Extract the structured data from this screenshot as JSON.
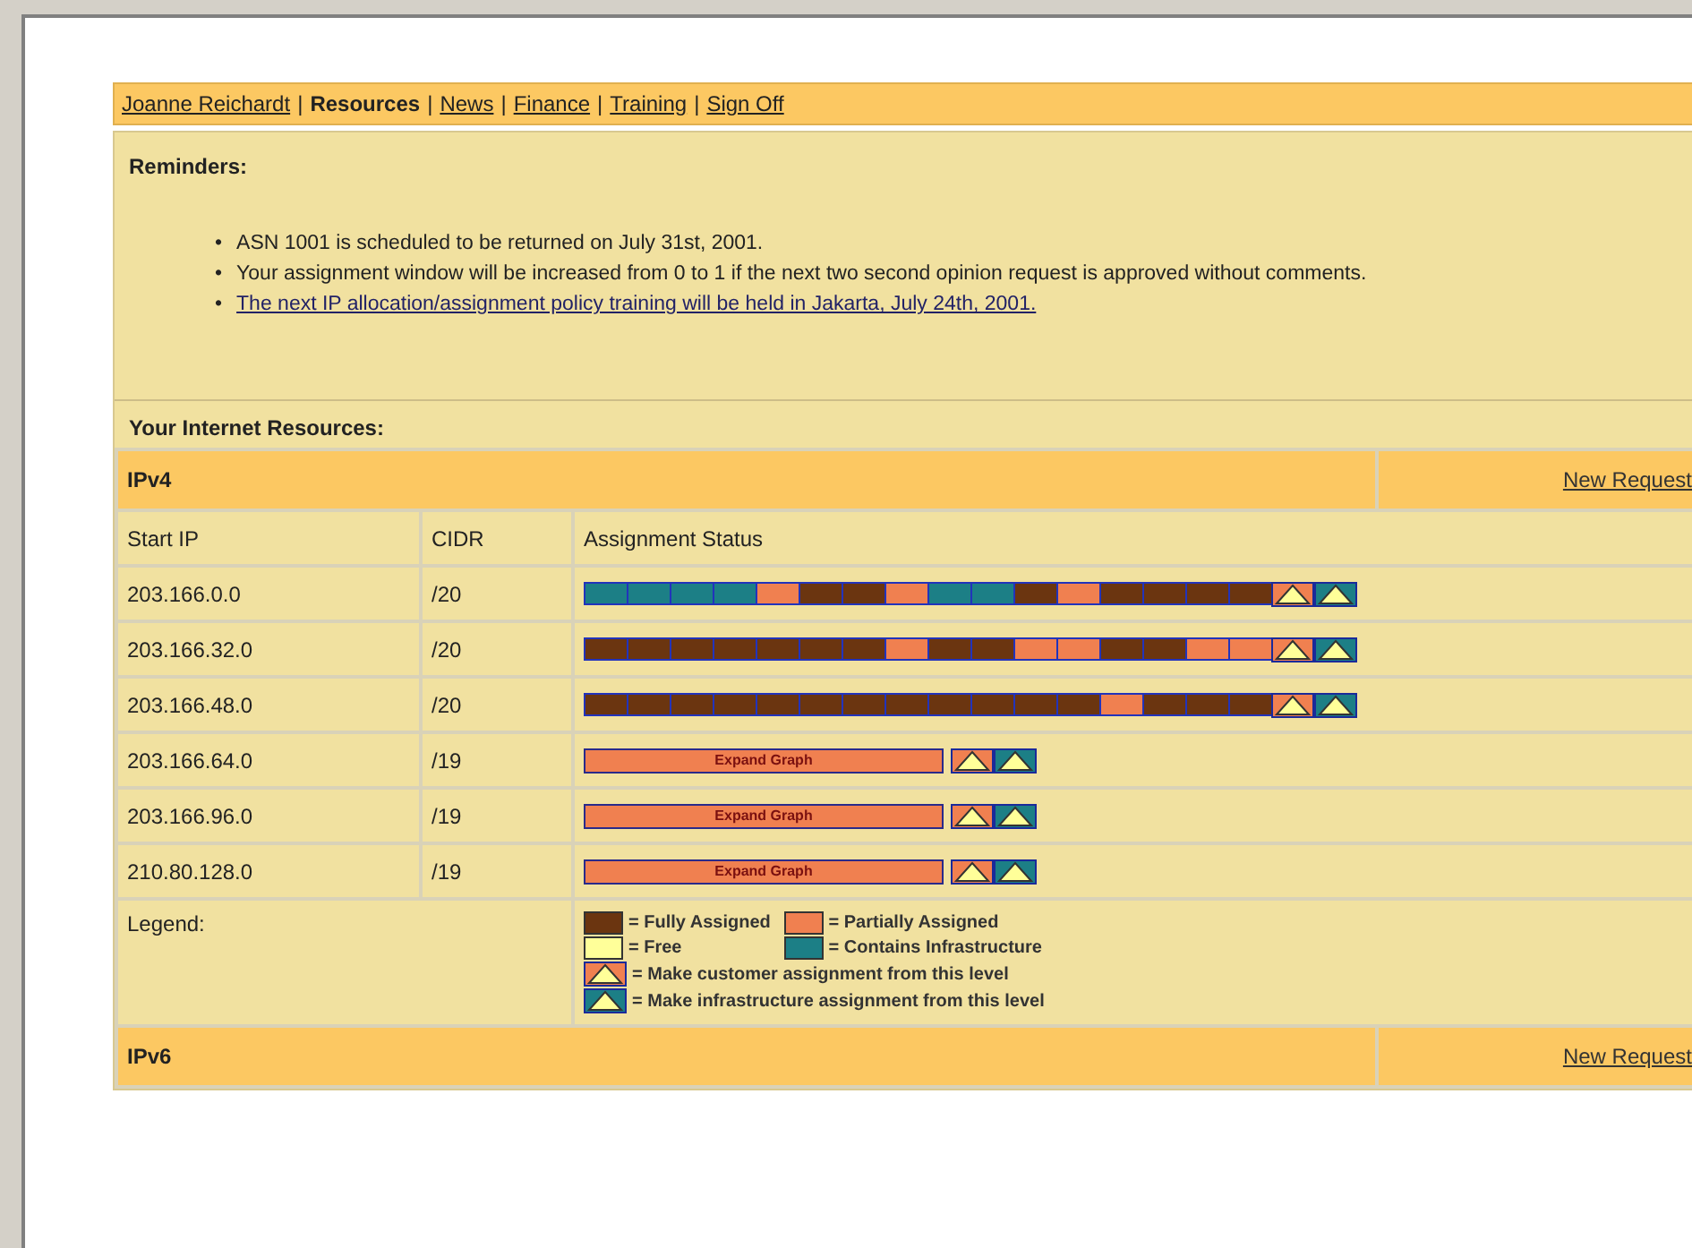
{
  "nav": [
    {
      "kind": "link",
      "label": "Joanne Reichardt",
      "selected": false
    },
    {
      "kind": "separator",
      "label": "|"
    },
    {
      "kind": "link",
      "label": "Resources",
      "selected": true
    },
    {
      "kind": "separator",
      "label": "|"
    },
    {
      "kind": "link",
      "label": "News",
      "selected": false
    },
    {
      "kind": "separator",
      "label": "|"
    },
    {
      "kind": "link",
      "label": "Finance",
      "selected": false
    },
    {
      "kind": "separator",
      "label": "|"
    },
    {
      "kind": "link",
      "label": "Training",
      "selected": false
    },
    {
      "kind": "separator",
      "label": "|"
    },
    {
      "kind": "link",
      "label": "Sign Off",
      "selected": false
    }
  ],
  "reminders": {
    "title": "Reminders:",
    "items": [
      {
        "bullet": "•",
        "text": "ASN 1001 is scheduled to be returned on July 31st, 2001.",
        "link": false
      },
      {
        "bullet": "•",
        "text": "Your assignment window will be increased from 0 to 1 if the next two second opinion request is approved without comments.",
        "link": false
      },
      {
        "bullet": "•",
        "text": "The next IP allocation/assignment policy training will be held in Jakarta, July 24th, 2001.",
        "link": true
      }
    ]
  },
  "resources": {
    "title": "Your Internet Resources:",
    "sections": [
      {
        "title": "IPv4",
        "action": "New Request",
        "columns": [
          "Start IP",
          "CIDR",
          "Assignment Status"
        ],
        "rows": [
          {
            "start_ip": "203.166.0.0",
            "cidr": "/20",
            "kind": "segments",
            "segments": [
              {
                "kind": "infra"
              },
              {
                "kind": "infra"
              },
              {
                "kind": "infra"
              },
              {
                "kind": "infra"
              },
              {
                "kind": "partial"
              },
              {
                "kind": "full"
              },
              {
                "kind": "full"
              },
              {
                "kind": "partial"
              },
              {
                "kind": "infra"
              },
              {
                "kind": "infra"
              },
              {
                "kind": "full"
              },
              {
                "kind": "partial"
              },
              {
                "kind": "full"
              },
              {
                "kind": "full"
              },
              {
                "kind": "full"
              },
              {
                "kind": "full"
              }
            ],
            "icons": [
              {
                "kind": "customer"
              },
              {
                "kind": "infra"
              }
            ]
          },
          {
            "start_ip": "203.166.32.0",
            "cidr": "/20",
            "kind": "segments",
            "segments": [
              {
                "kind": "full"
              },
              {
                "kind": "full"
              },
              {
                "kind": "full"
              },
              {
                "kind": "full"
              },
              {
                "kind": "full"
              },
              {
                "kind": "full"
              },
              {
                "kind": "full"
              },
              {
                "kind": "partial"
              },
              {
                "kind": "full"
              },
              {
                "kind": "full"
              },
              {
                "kind": "partial"
              },
              {
                "kind": "partial"
              },
              {
                "kind": "full"
              },
              {
                "kind": "full"
              },
              {
                "kind": "partial"
              },
              {
                "kind": "partial"
              }
            ],
            "icons": [
              {
                "kind": "customer"
              },
              {
                "kind": "infra"
              }
            ]
          },
          {
            "start_ip": "203.166.48.0",
            "cidr": "/20",
            "kind": "segments",
            "segments": [
              {
                "kind": "full"
              },
              {
                "kind": "full"
              },
              {
                "kind": "full"
              },
              {
                "kind": "full"
              },
              {
                "kind": "full"
              },
              {
                "kind": "full"
              },
              {
                "kind": "full"
              },
              {
                "kind": "full"
              },
              {
                "kind": "full"
              },
              {
                "kind": "full"
              },
              {
                "kind": "full"
              },
              {
                "kind": "full"
              },
              {
                "kind": "partial"
              },
              {
                "kind": "full"
              },
              {
                "kind": "full"
              },
              {
                "kind": "full"
              }
            ],
            "icons": [
              {
                "kind": "customer"
              },
              {
                "kind": "infra"
              }
            ]
          },
          {
            "start_ip": "203.166.64.0",
            "cidr": "/19",
            "kind": "collapsed",
            "expand_label": "Expand Graph",
            "icons": [
              {
                "kind": "customer"
              },
              {
                "kind": "infra"
              }
            ]
          },
          {
            "start_ip": "203.166.96.0",
            "cidr": "/19",
            "kind": "collapsed",
            "expand_label": "Expand Graph",
            "icons": [
              {
                "kind": "customer"
              },
              {
                "kind": "infra"
              }
            ]
          },
          {
            "start_ip": "210.80.128.0",
            "cidr": "/19",
            "kind": "collapsed",
            "expand_label": "Expand Graph",
            "icons": [
              {
                "kind": "customer"
              },
              {
                "kind": "infra"
              }
            ]
          }
        ],
        "legend": {
          "title": "Legend:",
          "entries": [
            {
              "kind": "full",
              "label": "= Fully Assigned"
            },
            {
              "kind": "partial",
              "label": "= Partially Assigned"
            },
            {
              "kind": "free",
              "label": "= Free"
            },
            {
              "kind": "infra",
              "label": "= Contains Infrastructure"
            },
            {
              "kind": "customer-level",
              "label": "= Make customer assignment from this level"
            },
            {
              "kind": "infra-level",
              "label": "= Make infrastructure assignment from this level"
            }
          ]
        }
      },
      {
        "title": "IPv6",
        "action": "New Request"
      }
    ]
  }
}
